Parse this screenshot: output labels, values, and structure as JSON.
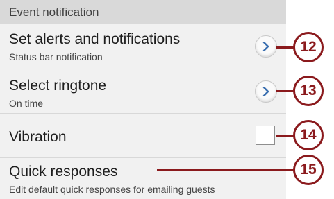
{
  "section": {
    "title": "Event notification"
  },
  "rows": [
    {
      "title": "Set alerts and notifications",
      "subtitle": "Status bar notification",
      "control": "chevron-right-icon"
    },
    {
      "title": "Select ringtone",
      "subtitle": "On time",
      "control": "chevron-right-icon"
    },
    {
      "title": "Vibration",
      "control": "checkbox",
      "checked": false
    },
    {
      "title": "Quick responses",
      "subtitle": "Edit default quick responses for emailing guests"
    }
  ],
  "callouts": [
    "12",
    "13",
    "14",
    "15"
  ],
  "colors": {
    "callout": "#8b1a1d",
    "header_bg": "#d9d9d9",
    "panel_bg": "#f1f1f1"
  }
}
